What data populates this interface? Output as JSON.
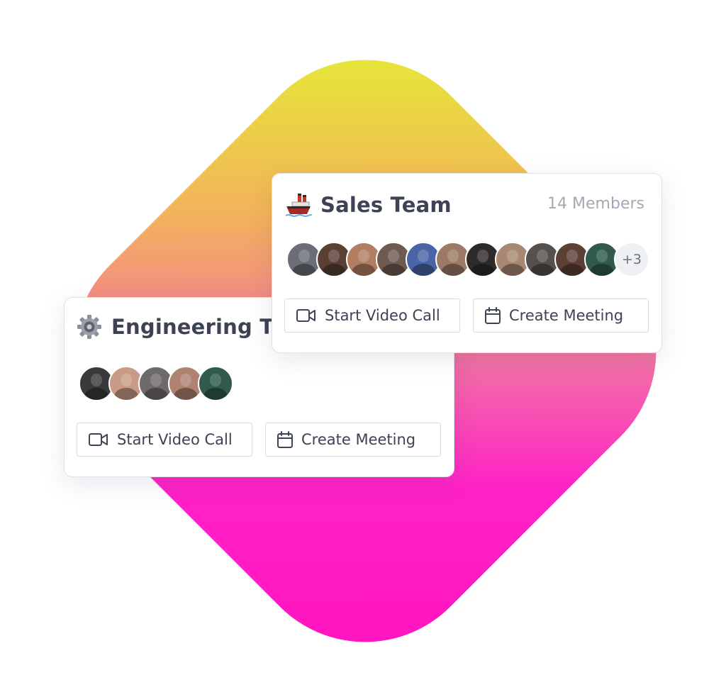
{
  "engineering_team": {
    "name": "Engineering Team",
    "icon": "gear-icon",
    "avatars": [
      "#3a3a3a",
      "#c99b86",
      "#6e6a6a",
      "#b08272",
      "#2f5a4c"
    ],
    "buttons": {
      "video_call": "Start Video Call",
      "create_meeting": "Create Meeting"
    }
  },
  "sales_team": {
    "name": "Sales Team",
    "icon": "ship-icon",
    "member_count": "14 Members",
    "avatars": [
      "#6b6e76",
      "#5a3f35",
      "#b17e62",
      "#6f5a52",
      "#4a64a8",
      "#9c7a66",
      "#2e2a2a",
      "#a88873",
      "#55504c",
      "#5c4036",
      "#2f5a4c"
    ],
    "more_label": "+3",
    "buttons": {
      "video_call": "Start Video Call",
      "create_meeting": "Create Meeting"
    }
  },
  "colors": {
    "background_gradient_start": "#e2f52e",
    "background_gradient_end": "#ff11bd",
    "text": "#3d4354",
    "muted": "#a4a9b6"
  }
}
